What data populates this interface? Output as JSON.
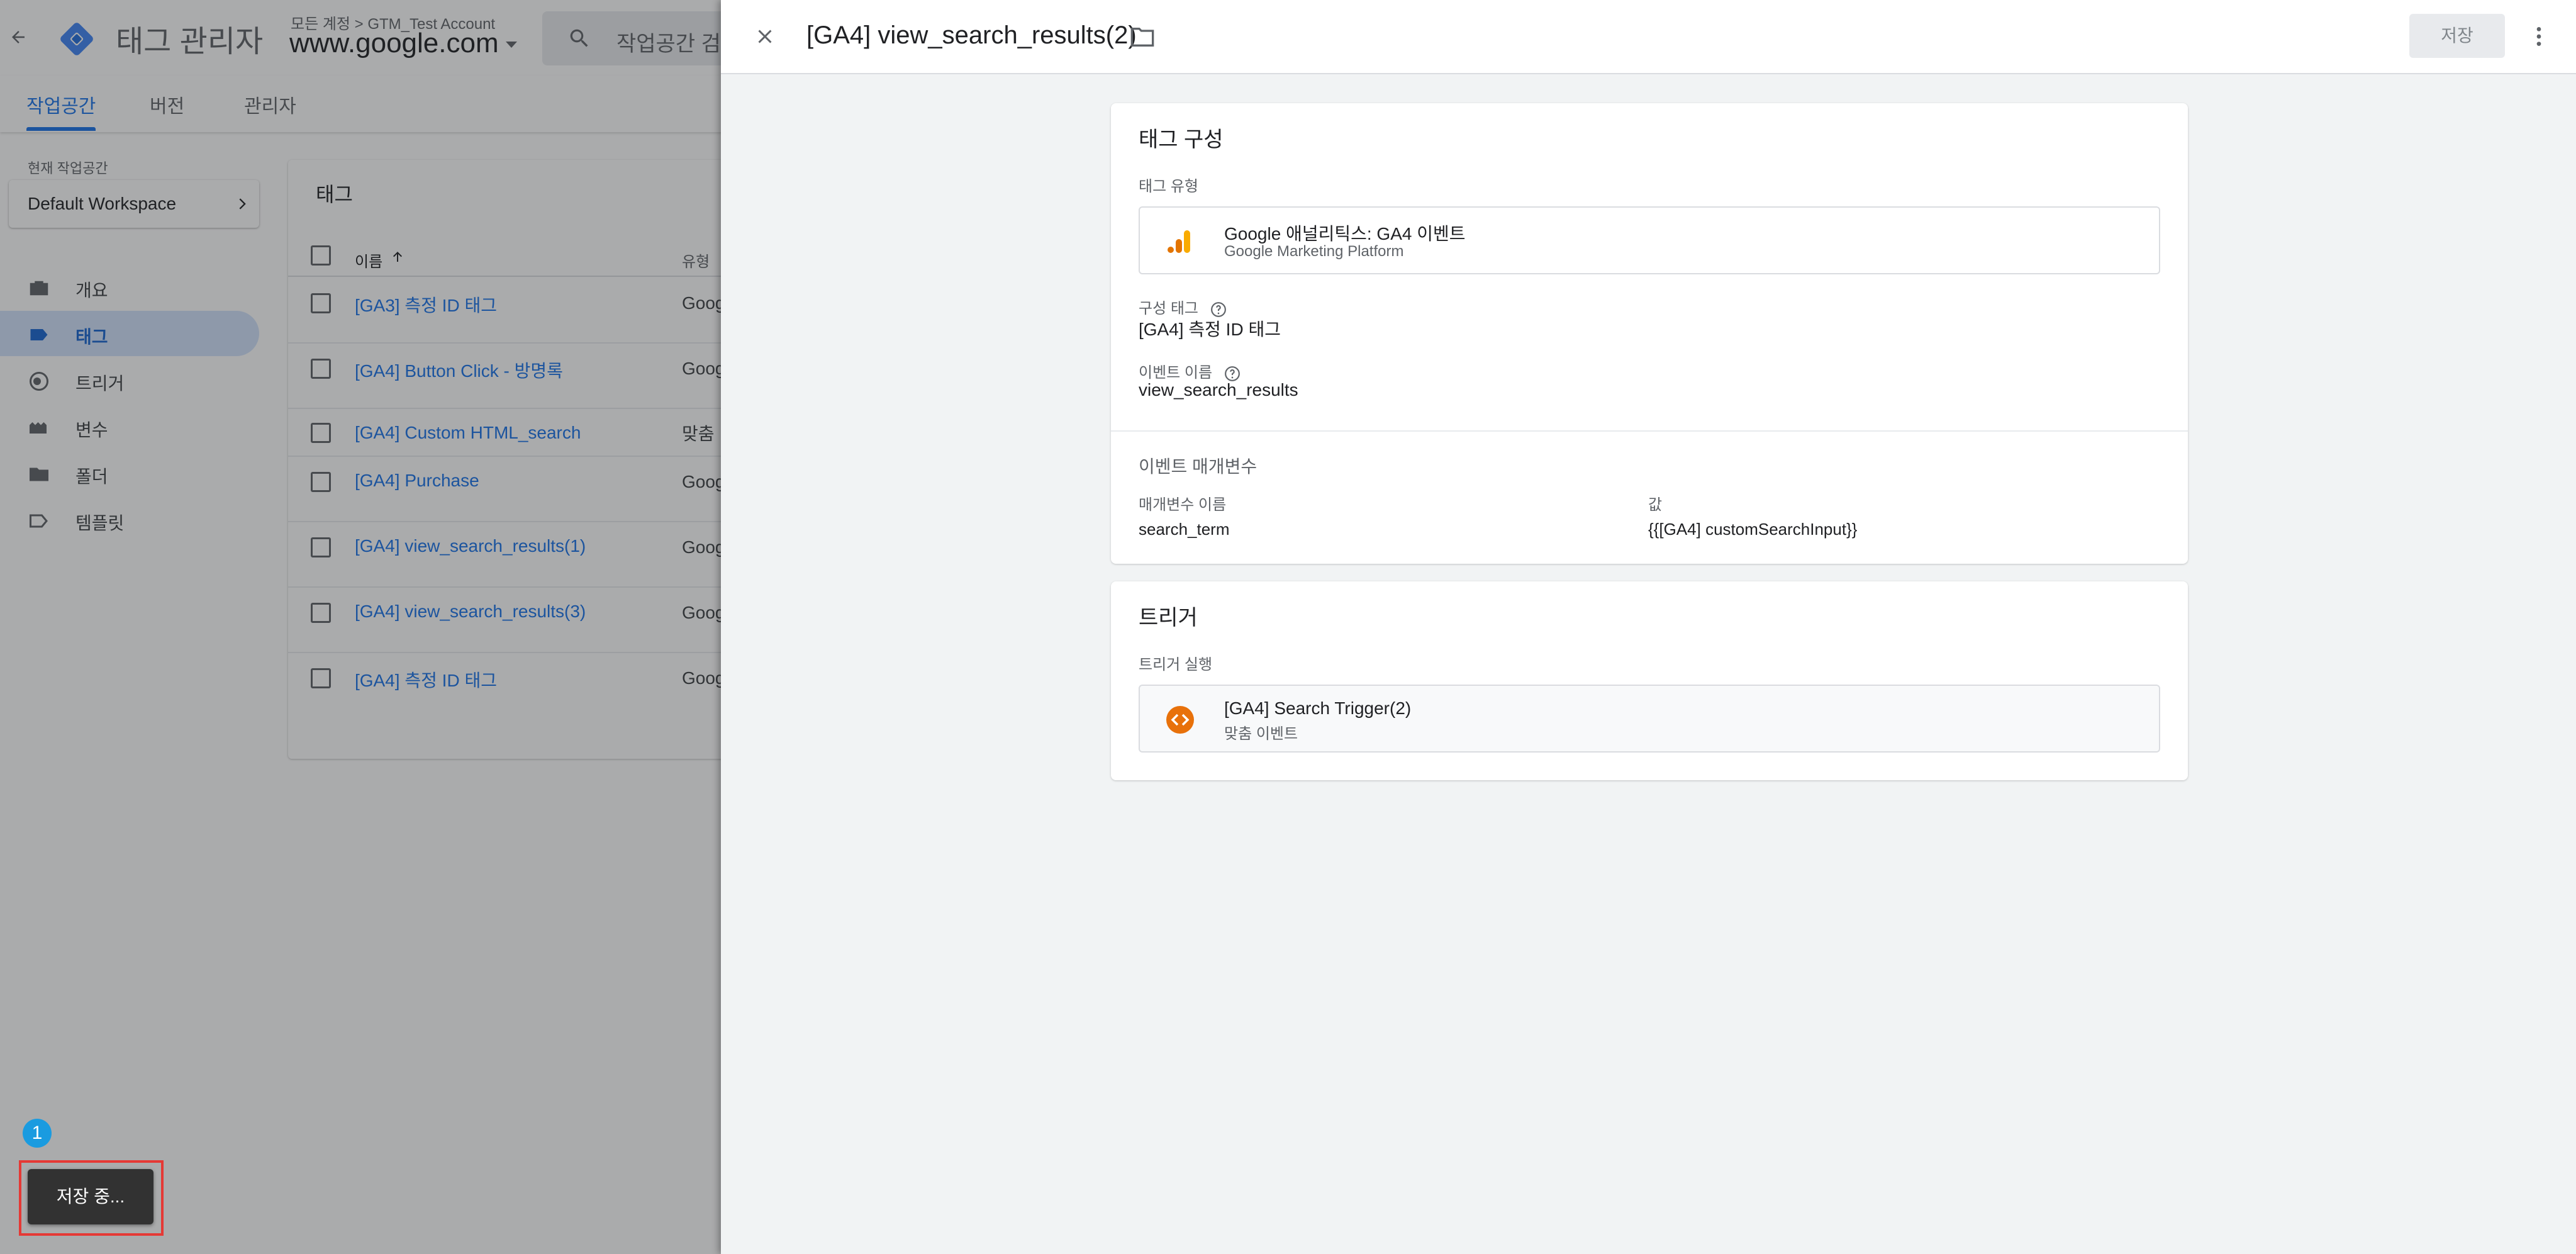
{
  "app": {
    "product_name": "태그 관리자",
    "account_crumb": "모든 계정 > GTM_Test Account",
    "container_name": "www.google.com",
    "search_placeholder": "작업공간 검색"
  },
  "tabs": [
    {
      "label": "작업공간",
      "active": true
    },
    {
      "label": "버전",
      "active": false
    },
    {
      "label": "관리자",
      "active": false
    }
  ],
  "workspace": {
    "caption": "현재 작업공간",
    "name": "Default Workspace"
  },
  "sidebar": {
    "items": [
      {
        "label": "개요",
        "icon": "briefcase-icon",
        "active": false
      },
      {
        "label": "태그",
        "icon": "tag-icon",
        "active": true
      },
      {
        "label": "트리거",
        "icon": "trigger-icon",
        "active": false
      },
      {
        "label": "변수",
        "icon": "variables-icon",
        "active": false
      },
      {
        "label": "폴더",
        "icon": "folder-icon",
        "active": false
      },
      {
        "label": "템플릿",
        "icon": "template-icon",
        "active": false
      }
    ]
  },
  "tags_list": {
    "title": "태그",
    "col_name": "이름",
    "col_type": "유형",
    "rows": [
      {
        "name": "[GA3] 측정 ID 태그",
        "type": "Goog 설 애"
      },
      {
        "name": "[GA4] Button Click - 방명록",
        "type": "Goog 벤트"
      },
      {
        "name": "[GA4] Custom HTML_search",
        "type": "맞춤"
      },
      {
        "name": "[GA4] Purchase",
        "type": "Goog 벤트"
      },
      {
        "name": "[GA4] view_search_results(1)",
        "type": "Goog 벤트"
      },
      {
        "name": "[GA4] view_search_results(3)",
        "type": "Goog 벤트"
      },
      {
        "name": "[GA4] 측정 ID 태그",
        "type": "Goog 성"
      }
    ]
  },
  "saving_chip": {
    "label": "저장 중...",
    "step_number": "1"
  },
  "panel": {
    "title": "[GA4] view_search_results(2)",
    "save_label": "저장",
    "config": {
      "title": "태그 구성",
      "tag_type_label": "태그 유형",
      "tag_type_name": "Google 애널리틱스: GA4 이벤트",
      "tag_type_vendor": "Google Marketing Platform",
      "config_tag_label": "구성 태그",
      "config_tag_value": "[GA4] 측정 ID 태그",
      "event_name_label": "이벤트 이름",
      "event_name_value": "view_search_results",
      "params_title": "이벤트 매개변수",
      "param_name_header": "매개변수 이름",
      "param_value_header": "값",
      "params": [
        {
          "name": "search_term",
          "value": "{{[GA4] customSearchInput}}"
        }
      ]
    },
    "triggering": {
      "title": "트리거",
      "label": "트리거 실행",
      "trigger_name": "[GA4] Search Trigger(2)",
      "trigger_type": "맞춤 이벤트"
    }
  },
  "colors": {
    "accent": "#1a73e8",
    "active_nav_bg": "#d2e3fc",
    "ga_orange": "#f9ab00",
    "trigger_orange": "#e8710a",
    "highlight_red": "#e53935",
    "badge_blue": "#1a9be0"
  }
}
